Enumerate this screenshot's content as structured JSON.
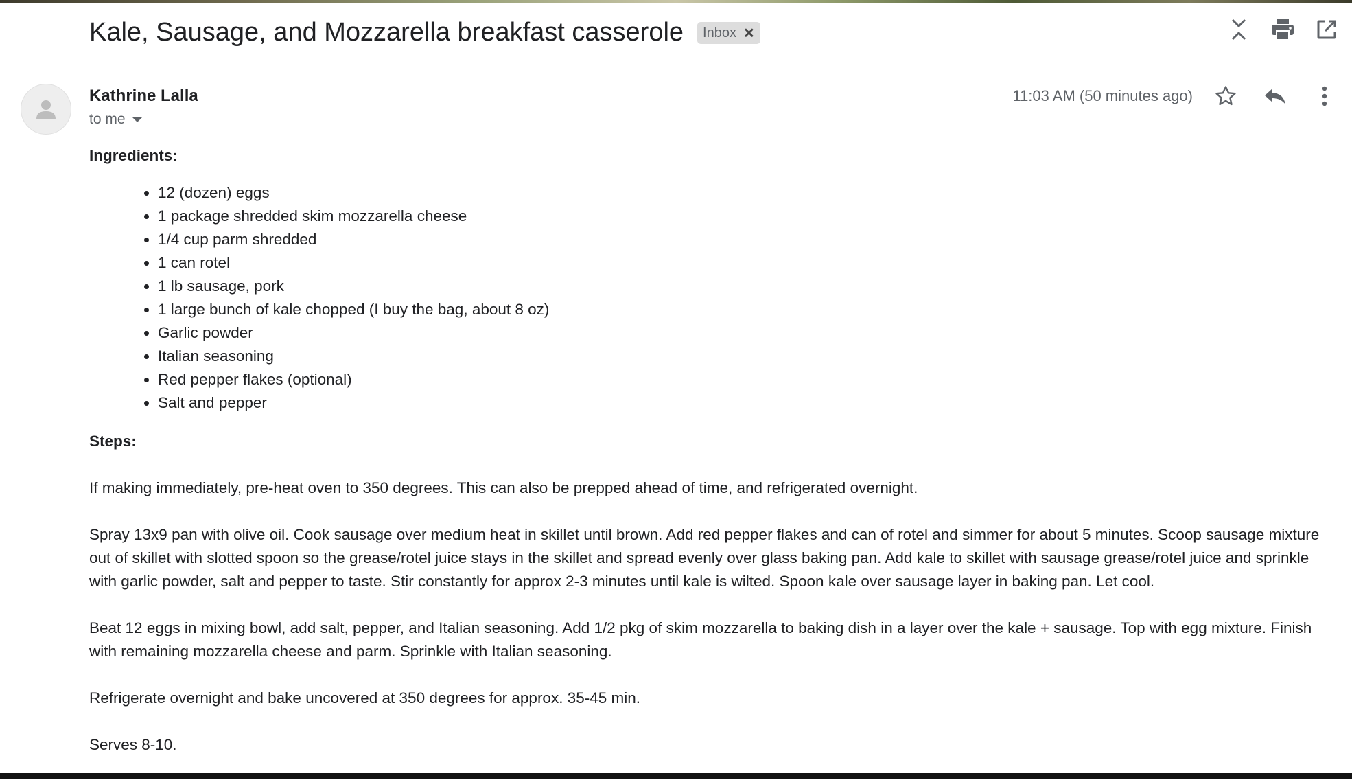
{
  "email": {
    "subject": "Kale, Sausage, and Mozzarella breakfast casserole",
    "label": "Inbox",
    "sender": "Kathrine Lalla",
    "recipient": "to me",
    "timestamp": "11:03 AM (50 minutes ago)"
  },
  "toolbar_icons": [
    "collapse-all-icon",
    "print-icon",
    "open-new-window-icon"
  ],
  "message_icons": [
    "star-icon",
    "reply-icon",
    "more-vert-icon"
  ],
  "content": {
    "ingredients_heading": "Ingredients:",
    "ingredients": [
      "12 (dozen) eggs",
      "1 package shredded skim mozzarella cheese",
      "1/4 cup parm shredded",
      "1 can rotel",
      "1 lb sausage, pork",
      "1 large bunch of kale chopped (I buy the bag, about 8 oz)",
      "Garlic powder",
      "Italian seasoning",
      "Red pepper flakes (optional)",
      "Salt and pepper"
    ],
    "steps_heading": "Steps:",
    "steps": [
      "If making immediately, pre-heat oven to 350 degrees. This can also be prepped ahead of time, and refrigerated overnight.",
      "Spray 13x9 pan with olive oil. Cook sausage over medium heat in skillet until brown. Add red pepper flakes and can of rotel and simmer for about 5 minutes. Scoop sausage mixture out of skillet with slotted spoon so the grease/rotel juice stays in the skillet and spread evenly over glass baking pan. Add kale to skillet with sausage grease/rotel juice and sprinkle with garlic powder, salt and pepper to taste. Stir constantly for approx 2-3 minutes until kale is wilted. Spoon kale over sausage layer in baking pan. Let cool.",
      "Beat 12 eggs in mixing bowl, add salt, pepper, and Italian seasoning. Add 1/2 pkg of skim mozzarella to baking dish in a layer over the kale + sausage. Top with egg mixture. Finish with remaining mozzarella cheese and parm. Sprinkle with Italian seasoning.",
      "Refrigerate overnight and bake uncovered at 350 degrees for approx. 35-45 min.",
      "Serves 8-10."
    ]
  }
}
